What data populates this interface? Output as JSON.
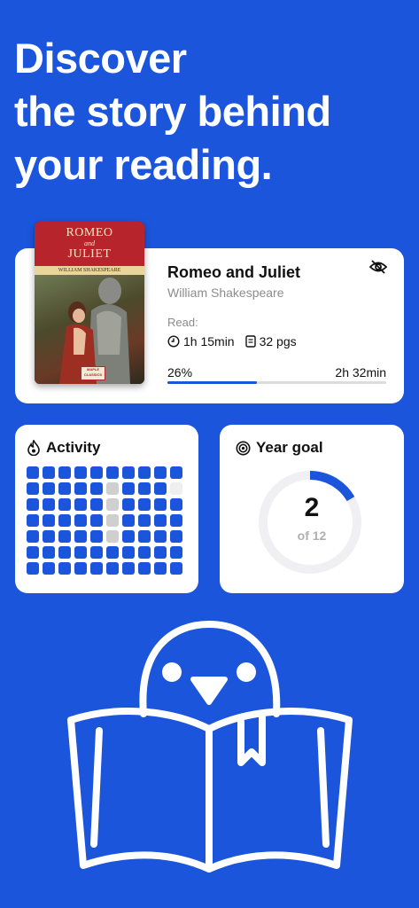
{
  "headline": {
    "line1": "Discover",
    "line2": "the story behind",
    "line3": "your reading."
  },
  "book": {
    "cover_title_line1": "ROMEO",
    "cover_title_and": "and",
    "cover_title_line2": "JULIET",
    "cover_author": "WILLIAM SHAKESPEARE",
    "cover_badge": "MAPLE CLASSICS",
    "title": "Romeo and Juliet",
    "author": "William Shakespeare",
    "read_label": "Read:",
    "read_time": "1h 15min",
    "pages": "32 pgs",
    "progress_label": "26%",
    "progress_fraction": 0.41,
    "remaining": "2h 32min",
    "icons": [
      "eye-slash-icon",
      "clock-icon",
      "page-icon"
    ]
  },
  "activity": {
    "title": "Activity",
    "icon": "flame-icon",
    "rows": [
      [
        "on",
        "on",
        "on",
        "on",
        "on",
        "on",
        "on",
        "on",
        "on",
        "on"
      ],
      [
        "on",
        "on",
        "on",
        "on",
        "on",
        "gray",
        "on",
        "on",
        "on",
        "light"
      ],
      [
        "on",
        "on",
        "on",
        "on",
        "on",
        "gray",
        "on",
        "on",
        "on",
        "on"
      ],
      [
        "on",
        "on",
        "on",
        "on",
        "on",
        "gray",
        "on",
        "on",
        "on",
        "on"
      ],
      [
        "on",
        "on",
        "on",
        "on",
        "on",
        "gray",
        "on",
        "on",
        "on",
        "on"
      ],
      [
        "on",
        "on",
        "on",
        "on",
        "on",
        "on",
        "on",
        "on",
        "on",
        "on"
      ],
      [
        "on",
        "on",
        "on",
        "on",
        "on",
        "on",
        "on",
        "on",
        "on",
        "on"
      ]
    ]
  },
  "goal": {
    "title": "Year goal",
    "icon": "target-icon",
    "value": "2",
    "of_text": "of 12",
    "fraction": 0.1667
  },
  "colors": {
    "brand": "#1b55dc",
    "card": "#ffffff",
    "muted": "#8c8c8c"
  },
  "illustration": "bird-reading-book-icon"
}
